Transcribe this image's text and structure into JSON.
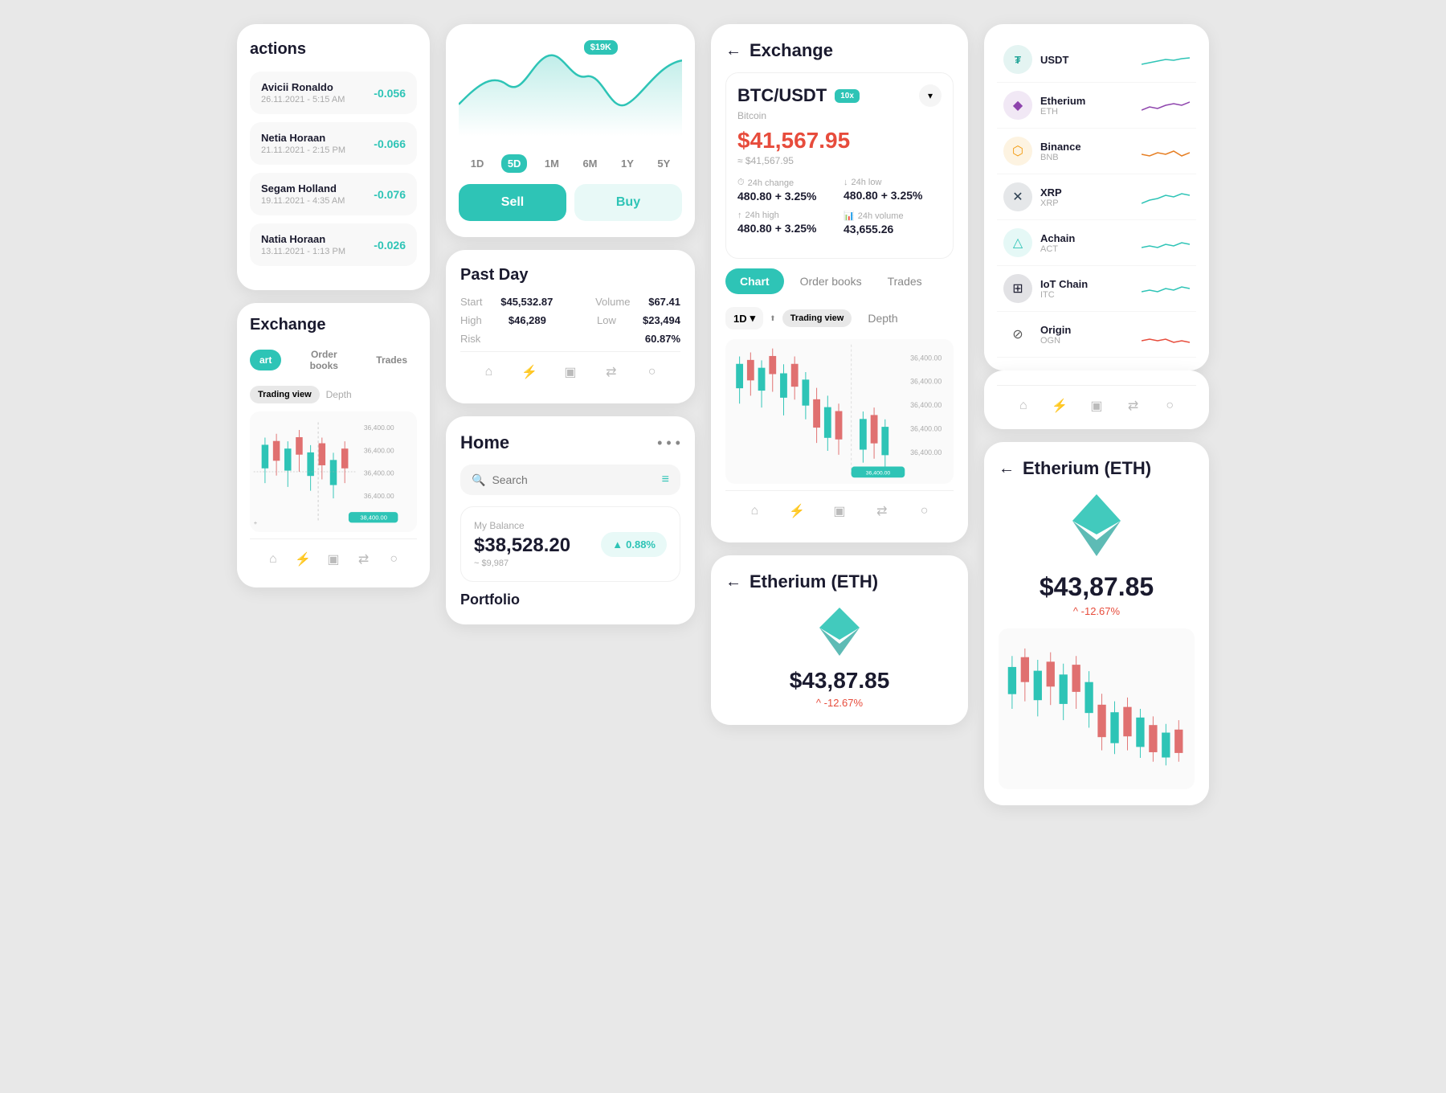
{
  "col1": {
    "transactions": {
      "title": "actions",
      "items": [
        {
          "name": "Avicii Ronaldo",
          "date": "26.11.2021 - 5:15 AM",
          "value": "-0.056"
        },
        {
          "name": "Netia Horaan",
          "date": "21.11.2021 - 2:15 PM",
          "value": "-0.066"
        },
        {
          "name": "Segam Holland",
          "date": "19.11.2021 - 4:35 AM",
          "value": "-0.076"
        },
        {
          "name": "Natia Horaan",
          "date": "13.11.2021 - 1:13 PM",
          "value": "-0.026"
        }
      ]
    },
    "exchange": {
      "title": "Exchange",
      "tabs": [
        "art",
        "Order books",
        "Trades"
      ],
      "subtabs": [
        "Trading view",
        "Depth"
      ]
    }
  },
  "col2": {
    "chart": {
      "price_badge": "$19K",
      "time_options": [
        "1D",
        "5D",
        "1M",
        "6M",
        "1Y",
        "5Y"
      ],
      "active_time": "5D",
      "sell_label": "Sell",
      "buy_label": "Buy"
    },
    "past_day": {
      "title": "Past Day",
      "start_label": "Start",
      "start_value": "$45,532.87",
      "volume_label": "Volume",
      "volume_value": "$67.41",
      "high_label": "High",
      "high_value": "$46,289",
      "low_label": "Low",
      "low_value": "$23,494",
      "risk_label": "Risk",
      "risk_value": "60.87%"
    },
    "home": {
      "title": "Home",
      "search_placeholder": "Search",
      "balance_label": "My Balance",
      "balance_amount": "$38,528.20",
      "balance_sub": "~ $9,987",
      "balance_badge": "0.88%",
      "portfolio_title": "Portfolio"
    }
  },
  "col3": {
    "exchange": {
      "title": "Exchange",
      "pair": "BTC/USDT",
      "leverage": "10x",
      "coin_name": "Bitcoin",
      "price": "$41,567.95",
      "price_sub": "≈ $41,567.95",
      "change_24h_label": "24h change",
      "change_24h_value": "480.80 + 3.25%",
      "low_24h_label": "24h low",
      "low_24h_value": "480.80 + 3.25%",
      "high_24h_label": "24h high",
      "high_24h_value": "480.80 + 3.25%",
      "volume_24h_label": "24h volume",
      "volume_24h_value": "43,655.26",
      "tabs": [
        "Chart",
        "Order books",
        "Trades"
      ],
      "subtabs_period": "1D",
      "subtabs": [
        "Trading view",
        "Depth"
      ],
      "price_levels": [
        "36,400.00",
        "36,400.00",
        "36,400.00",
        "36,400.00",
        "36,400.00"
      ]
    },
    "eth_mid": {
      "title": "Etherium (ETH)",
      "price": "$43,87.85",
      "change": "^ -12.67%"
    }
  },
  "col4": {
    "crypto_list": {
      "items": [
        {
          "name": "Etherium",
          "symbol": "ETH",
          "color": "#8e44ad",
          "icon": "◆"
        },
        {
          "name": "Binance",
          "symbol": "BNB",
          "color": "#f39c12",
          "icon": "⬡"
        },
        {
          "name": "XRP",
          "symbol": "XRP",
          "color": "#2c3e50",
          "icon": "✕"
        },
        {
          "name": "Achain",
          "symbol": "ACT",
          "color": "#2ec4b6",
          "icon": "△"
        },
        {
          "name": "IoT Chain",
          "symbol": "ITC",
          "color": "#1a1a2e",
          "icon": "⊞"
        },
        {
          "name": "Origin",
          "symbol": "OGN",
          "color": "#555",
          "icon": "⊘"
        }
      ]
    },
    "eth_detail": {
      "title": "Etherium (ETH)",
      "price": "$43,87.85",
      "change": "^ -12.67%"
    }
  },
  "nav": {
    "home_icon": "⌂",
    "flash_icon": "⚡",
    "wallet_icon": "▣",
    "transfer_icon": "⇄",
    "profile_icon": "○"
  }
}
